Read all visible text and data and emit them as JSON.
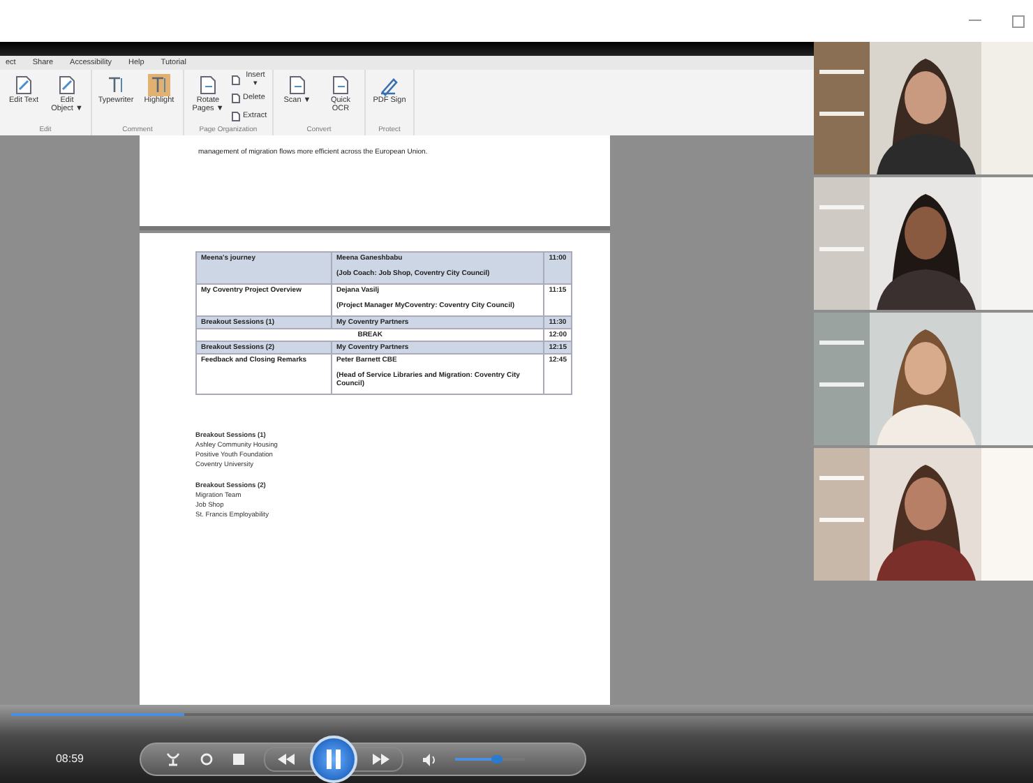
{
  "ribbon": {
    "tabs": [
      {
        "label": "ect",
        "selected": false
      },
      {
        "label": "Share",
        "selected": false
      },
      {
        "label": "Accessibility",
        "selected": false
      },
      {
        "label": "Help",
        "selected": false
      },
      {
        "label": "Tutorial",
        "selected": false
      }
    ],
    "groups": [
      {
        "label": "Edit",
        "tools": [
          {
            "kind": "edit",
            "label": "Edit Text",
            "selected": false
          },
          {
            "kind": "edit",
            "label": "Edit Object ▼",
            "selected": false
          }
        ]
      },
      {
        "label": "Comment",
        "tools": [
          {
            "kind": "type",
            "label": "Typewriter",
            "selected": false
          },
          {
            "kind": "type",
            "label": "Highlight",
            "selected": true
          }
        ]
      },
      {
        "label": "Page Organization",
        "tools": [
          {
            "kind": "page",
            "label": "Rotate Pages ▼",
            "selected": false
          },
          {
            "kind": "small",
            "label": "Insert ▾",
            "selected": false
          },
          {
            "kind": "small",
            "label": "Delete",
            "selected": false
          },
          {
            "kind": "small",
            "label": "Extract",
            "selected": false
          }
        ]
      },
      {
        "label": "Convert",
        "tools": [
          {
            "kind": "page",
            "label": "Scan ▼",
            "selected": false
          },
          {
            "kind": "page",
            "label": "Quick OCR",
            "selected": false
          }
        ]
      },
      {
        "label": "Protect",
        "tools": [
          {
            "kind": "sign",
            "label": "PDF Sign",
            "selected": false
          }
        ]
      }
    ]
  },
  "document": {
    "page_text": "management of migration flows more efficient across the European Union.",
    "table": {
      "rows": [
        {
          "shaded": true,
          "cells": [
            {
              "text": "Meena's journey"
            },
            {
              "text": "Meena Ganeshbabu",
              "note": "(Job Coach: Job Shop, Coventry City Council)"
            },
            {
              "text": "11:00"
            }
          ]
        },
        {
          "shaded": false,
          "cells": [
            {
              "text": "My Coventry Project Overview"
            },
            {
              "text": "Dejana Vasilj",
              "note": "(Project Manager MyCoventry: Coventry City Council)"
            },
            {
              "text": "11:15"
            }
          ]
        },
        {
          "shaded": true,
          "cells": [
            {
              "text": "Breakout Sessions (1)"
            },
            {
              "text": "My Coventry Partners"
            },
            {
              "text": "11:30"
            }
          ]
        },
        {
          "shaded": false,
          "cells": [
            {
              "text": "BREAK",
              "colspan": 2
            },
            {
              "text": "12:00"
            }
          ]
        },
        {
          "shaded": true,
          "cells": [
            {
              "text": "Breakout Sessions (2)"
            },
            {
              "text": "My Coventry Partners"
            },
            {
              "text": "12:15"
            }
          ]
        },
        {
          "shaded": false,
          "cells": [
            {
              "text": "Feedback and Closing Remarks"
            },
            {
              "text": "Peter Barnett CBE",
              "note": "(Head of Service Libraries and Migration: Coventry City Council)"
            },
            {
              "text": "12:45"
            }
          ]
        }
      ]
    },
    "notes": [
      {
        "heading": "Breakout Sessions (1)",
        "items": [
          "Ashley Community Housing",
          "Positive Youth Foundation",
          "Coventry University"
        ]
      },
      {
        "heading": "Breakout Sessions (2)",
        "items": [
          "Migration Team",
          "Job Shop",
          "St. Francis Employability"
        ]
      }
    ]
  },
  "player": {
    "time": "08:59",
    "playing": true,
    "progress": {
      "level": 0.17
    },
    "volume": {
      "level": 0.6
    }
  }
}
